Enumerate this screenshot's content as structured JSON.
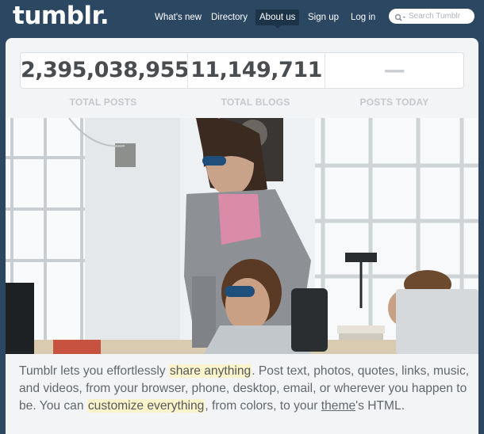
{
  "header": {
    "logo": "tumblr.",
    "nav": [
      {
        "label": "What's new",
        "active": false
      },
      {
        "label": "Directory",
        "active": false
      },
      {
        "label": "About us",
        "active": true
      },
      {
        "label": "Sign up",
        "active": false
      },
      {
        "label": "Log in",
        "active": false
      }
    ],
    "search": {
      "placeholder": "Search Tumblr",
      "value": ""
    }
  },
  "stats": [
    {
      "value": "2,395,038,955",
      "label": "TOTAL POSTS"
    },
    {
      "value": "11,149,711",
      "label": "TOTAL BLOGS"
    },
    {
      "value": "—",
      "label": "POSTS TODAY"
    }
  ],
  "description": {
    "t1": "Tumblr lets you effortlessly ",
    "h1": "share anything",
    "t2": ". Post text, photos, quotes, links, music, and videos, from your browser, phone, desktop, email, or wherever you happen to be. You can ",
    "h2": "customize everything",
    "t3": ", from colors, to your ",
    "link": "theme",
    "t4": "'s HTML."
  },
  "colors": {
    "background": "#2c4762",
    "panel": "#f3f4f5",
    "highlight": "#fbf3c9",
    "stat_text": "#4a4d50",
    "stat_label": "#c4c8cc"
  },
  "icons": {
    "search": "magnifier-with-dropdown-icon"
  }
}
